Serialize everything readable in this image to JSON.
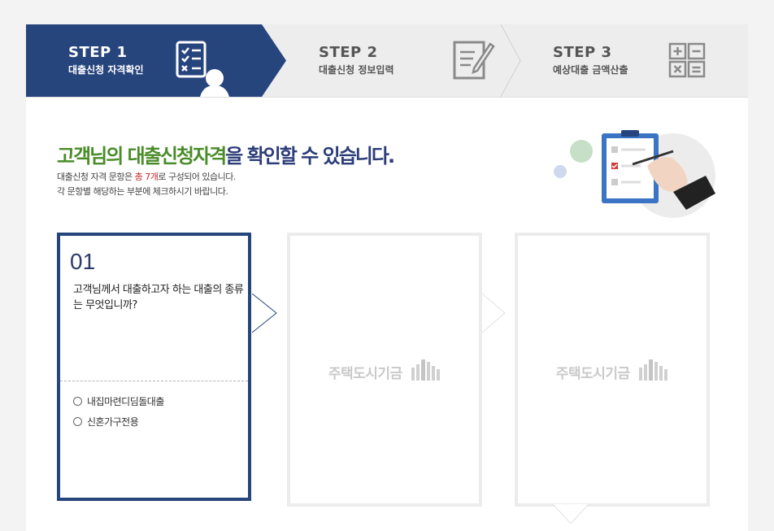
{
  "steps": [
    {
      "num": "STEP 1",
      "label": "대출신청 자격확인",
      "active": true
    },
    {
      "num": "STEP 2",
      "label": "대출신청 정보입력",
      "active": false
    },
    {
      "num": "STEP 3",
      "label": "예상대출 금액산출",
      "active": false
    }
  ],
  "heading": {
    "green": "고객님의 대출신청자격",
    "rest": "을 확인할 수 있습니다."
  },
  "description": {
    "line1_pre": "대출신청 자격 문항은 ",
    "line1_red": "총 7개",
    "line1_post": "로 구성되어 있습니다.",
    "line2": "각 문항별 해당하는 부분에 체크하시기 바랍니다."
  },
  "question": {
    "number": "01",
    "text": "고객님께서 대출하고자 하는 대출의 종류는 무엇입니까?",
    "options": [
      "내집마련디딤돌대출",
      "신혼가구전용"
    ]
  },
  "placeholders": [
    "주택도시기금",
    "주택도시기금"
  ],
  "colors": {
    "navy": "#27457d",
    "green": "#4a8c2a",
    "red": "#c6242b"
  }
}
